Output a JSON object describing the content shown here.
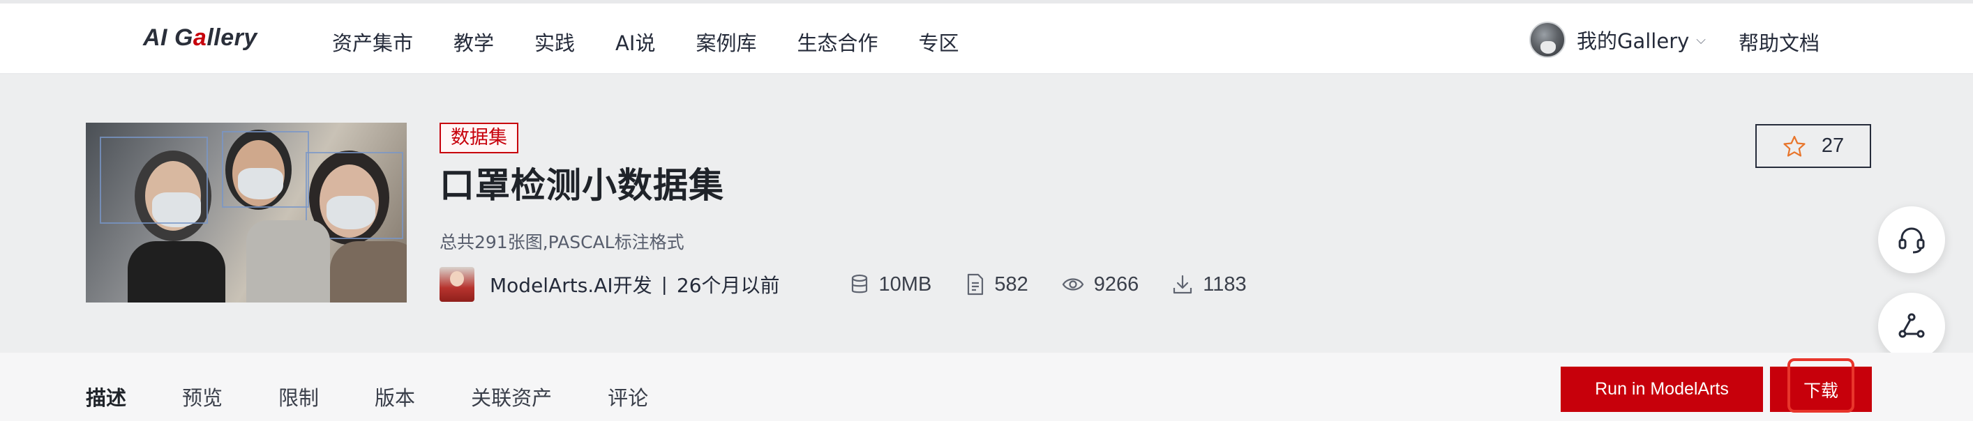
{
  "header": {
    "logo_text_a": "AI G",
    "logo_text_accent": "a",
    "logo_text_b": "llery",
    "nav": [
      "资产集市",
      "教学",
      "实践",
      "AI说",
      "案例库",
      "生态合作",
      "专区"
    ],
    "user_label": "我的Gallery",
    "help_label": "帮助文档"
  },
  "asset": {
    "tag": "数据集",
    "title": "口罩检测小数据集",
    "description": "总共291张图,PASCAL标注格式",
    "author": "ModelArts.AI开发",
    "separator": "|",
    "published": "26个月以前",
    "size": "10MB",
    "files": "582",
    "views": "9266",
    "downloads": "1183",
    "favorites": "27"
  },
  "tabs": [
    "描述",
    "预览",
    "限制",
    "版本",
    "关联资产",
    "评论"
  ],
  "actions": {
    "run_label": "Run in ModelArts",
    "download_label": "下载"
  },
  "colors": {
    "brand_red": "#c7000b",
    "star_orange": "#e8752b"
  },
  "icons": {
    "float_1": "headset-icon",
    "float_2": "share-nodes-icon",
    "float_3": "smiley-icon"
  }
}
